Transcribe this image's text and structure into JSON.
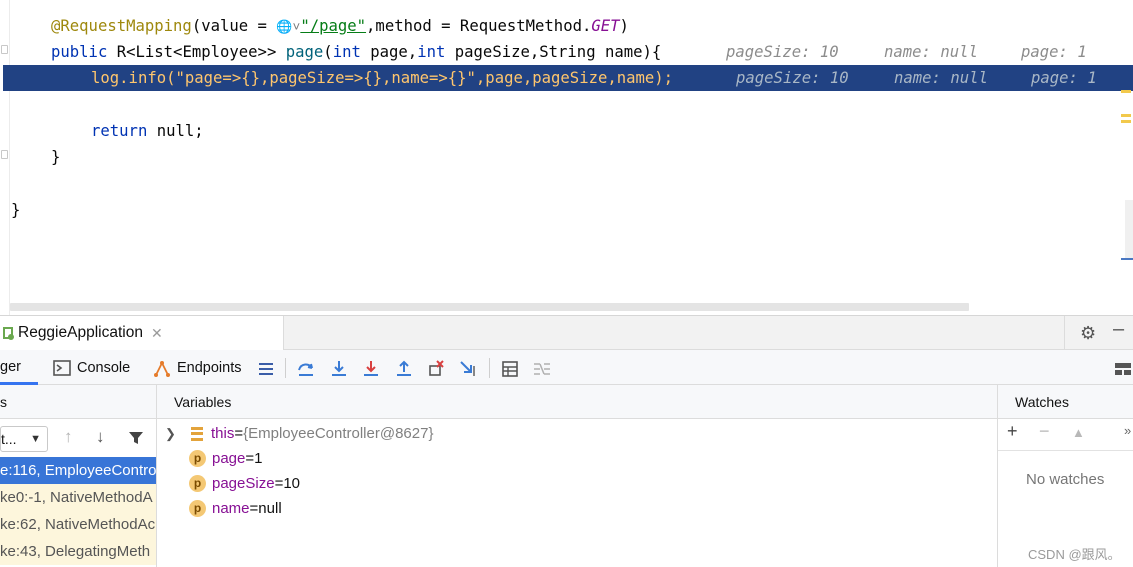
{
  "editor": {
    "line1": {
      "annotation": "@RequestMapping",
      "pre": "(value = ",
      "url": "\"/page\"",
      "post": ",method = RequestMethod.",
      "const": "GET",
      "close": ")"
    },
    "line2": {
      "kw_public": "public",
      "type": " R<List<Employee>> ",
      "method": "page",
      "params_open": "(",
      "kw_int1": "int",
      "p1": " page,",
      "kw_int2": "int",
      "p2": " pageSize,String name){",
      "hints": [
        "pageSize: 10",
        "name: null",
        "page: 1"
      ]
    },
    "line3": {
      "code": "log.info(\"page=>{},pageSize=>{},name=>{}\",page,pageSize,name);",
      "hints": [
        "pageSize: 10",
        "name: null",
        "page: 1"
      ]
    },
    "line5": {
      "kw_return": "return",
      "rest": " null;"
    },
    "line6": {
      "brace": "}"
    },
    "line8": {
      "brace": "}"
    }
  },
  "debug": {
    "run_tab_label": "ReggieApplication",
    "tabs": {
      "debugger": "ger",
      "console": "Console",
      "endpoints": "Endpoints"
    },
    "frames": {
      "header": "s",
      "thread_value": "t...",
      "rows": [
        "e:116, EmployeeContro",
        "ke0:-1, NativeMethodA",
        "ke:62, NativeMethodAc",
        "ke:43, DelegatingMeth"
      ]
    },
    "variables": {
      "header": "Variables",
      "rows": [
        {
          "icon": "field",
          "name": "this",
          "eq": " = ",
          "value": "{EmployeeController@8627}"
        },
        {
          "icon": "p",
          "name": "page",
          "eq": " = ",
          "value": "1"
        },
        {
          "icon": "p",
          "name": "pageSize",
          "eq": " = ",
          "value": "10"
        },
        {
          "icon": "p",
          "name": "name",
          "eq": " = ",
          "value": "null"
        }
      ]
    },
    "watches": {
      "header": "Watches",
      "empty": "No watches"
    }
  },
  "watermark": "CSDN @跟风。",
  "colors": {
    "current_line": "#214283",
    "selection": "#3875d7",
    "accent": "#3574f0"
  }
}
